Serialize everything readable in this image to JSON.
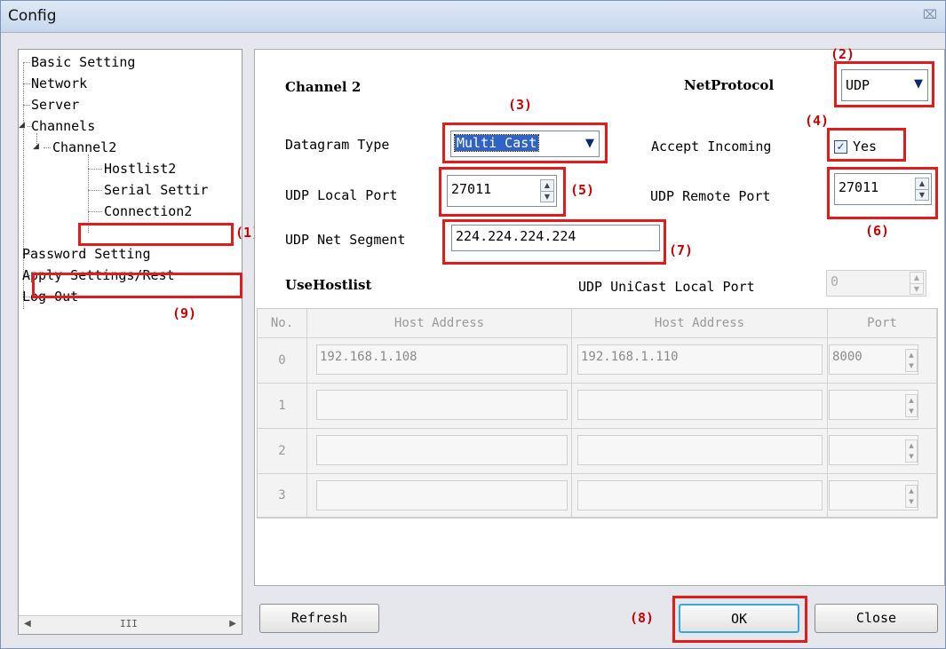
{
  "window": {
    "title": "Config",
    "close_glyph": "⌧"
  },
  "tree": {
    "items": [
      {
        "label": "Basic Setting"
      },
      {
        "label": "Network"
      },
      {
        "label": "Server"
      },
      {
        "label": "Channels"
      },
      {
        "label": "Channel2"
      },
      {
        "label": "Hostlist2"
      },
      {
        "label": "Serial Settir"
      },
      {
        "label": "Connection2"
      },
      {
        "label": "Password Setting"
      },
      {
        "label": "Apply Settings/Rest"
      },
      {
        "label": "Log Out"
      }
    ],
    "scroll_grip": "III"
  },
  "panel": {
    "channel_title": "Channel 2",
    "net_protocol_label": "NetProtocol",
    "net_protocol_value": "UDP",
    "datagram_type_label": "Datagram Type",
    "datagram_type_value": "Multi Cast",
    "accept_incoming_label": "Accept Incoming",
    "accept_incoming_option": "Yes",
    "accept_incoming_checked": true,
    "udp_local_port_label": "UDP Local Port",
    "udp_local_port_value": "27011",
    "udp_remote_port_label": "UDP Remote Port",
    "udp_remote_port_value": "27011",
    "udp_net_segment_label": "UDP Net Segment",
    "udp_net_segment_value": "224.224.224.224",
    "use_hostlist_label": "UseHostlist",
    "udp_unicast_local_port_label": "UDP UniCast Local Port",
    "udp_unicast_local_port_value": "0"
  },
  "hostlist": {
    "headers": [
      "No.",
      "Host Address",
      "Host Address",
      "Port"
    ],
    "rows": [
      {
        "no": "0",
        "host1": "192.168.1.108",
        "host2": "192.168.1.110",
        "port": "8000"
      },
      {
        "no": "1",
        "host1": "",
        "host2": "",
        "port": ""
      },
      {
        "no": "2",
        "host1": "",
        "host2": "",
        "port": ""
      },
      {
        "no": "3",
        "host1": "",
        "host2": "",
        "port": ""
      }
    ]
  },
  "buttons": {
    "refresh": "Refresh",
    "ok": "OK",
    "close": "Close"
  },
  "annotations": {
    "a1": "(1)",
    "a2": "(2)",
    "a3": "(3)",
    "a4": "(4)",
    "a5": "(5)",
    "a6": "(6)",
    "a7": "(7)",
    "a8": "(8)",
    "a9": "(9)"
  },
  "colors": {
    "annotation_red": "#e21b1b",
    "selection_blue": "#3163c5",
    "focus_border": "#3aa6e0"
  }
}
